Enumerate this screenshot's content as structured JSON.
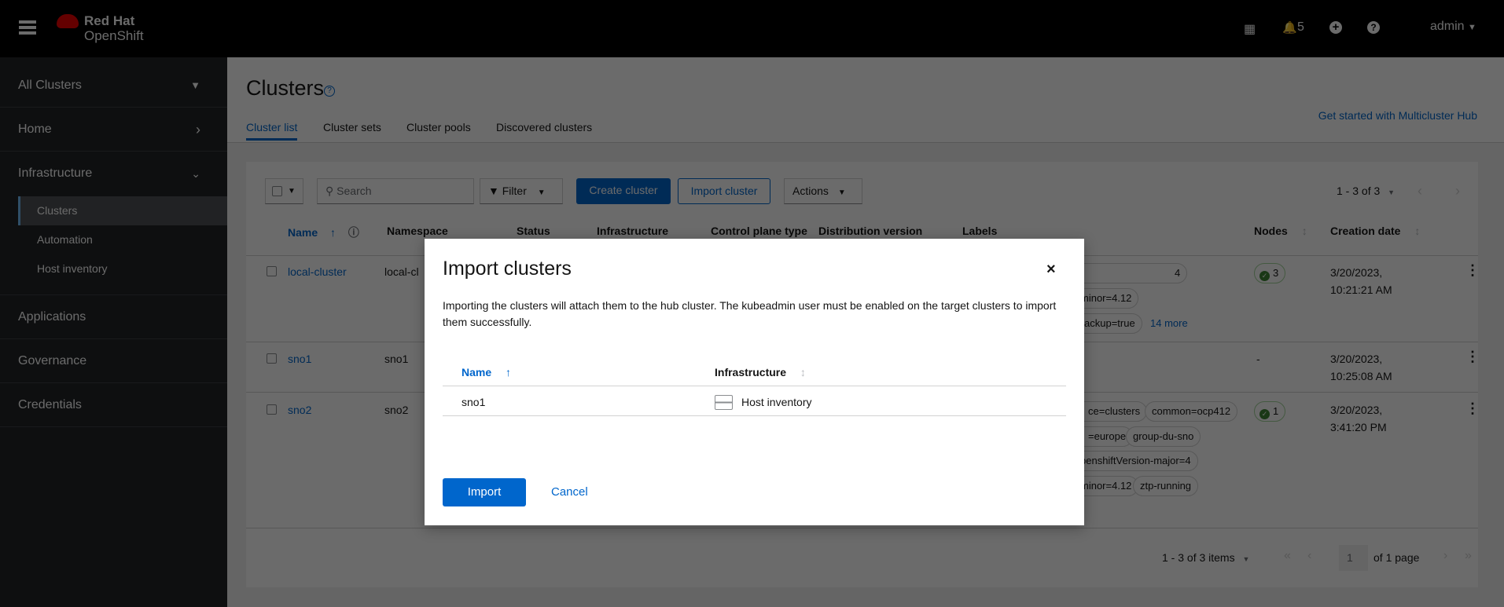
{
  "masthead": {
    "brand_line1": "Red Hat",
    "brand_line2": "OpenShift",
    "notification_count": "5",
    "user": "admin"
  },
  "sidebar": {
    "perspective": "All Clusters",
    "items": [
      {
        "label": "Home"
      },
      {
        "label": "Infrastructure"
      },
      {
        "label": "Applications"
      },
      {
        "label": "Governance"
      },
      {
        "label": "Credentials"
      }
    ],
    "infrastructure_sub": [
      {
        "label": "Clusters"
      },
      {
        "label": "Automation"
      },
      {
        "label": "Host inventory"
      }
    ]
  },
  "page": {
    "title": "Clusters",
    "tabs": [
      {
        "label": "Cluster list"
      },
      {
        "label": "Cluster sets"
      },
      {
        "label": "Cluster pools"
      },
      {
        "label": "Discovered clusters"
      }
    ],
    "get_started_link": "Get started with Multicluster Hub"
  },
  "toolbar": {
    "search_placeholder": "Search",
    "filter": "Filter",
    "create_cluster": "Create cluster",
    "import_cluster": "Import cluster",
    "actions": "Actions",
    "pagination": "1 - 3 of 3"
  },
  "table": {
    "headers": [
      "Name",
      "Namespace",
      "Status",
      "Infrastructure",
      "Control plane type",
      "Distribution version",
      "Labels",
      "Nodes",
      "Creation date"
    ],
    "rows": [
      {
        "name": "local-cluster",
        "namespace": "local-cl",
        "labels": [
          "4",
          "minor=4.12",
          "ackup=true"
        ],
        "more_labels": "14 more",
        "nodes": "3",
        "created_1": "3/20/2023,",
        "created_2": "10:21:21 AM"
      },
      {
        "name": "sno1",
        "namespace": "sno1",
        "labels": [],
        "nodes": "-",
        "created_1": "3/20/2023,",
        "created_2": "10:25:08 AM"
      },
      {
        "name": "sno2",
        "namespace": "sno2",
        "labels": [
          "ce=clusters",
          "common=ocp412",
          "=europe",
          "group-du-sno",
          "penshiftVersion-major=4",
          "minor=4.12",
          "ztp-running"
        ],
        "nodes": "1",
        "created_1": "3/20/2023,",
        "created_2": "3:41:20 PM"
      }
    ]
  },
  "footer_pagination": {
    "range": "1 - 3 of 3 items",
    "page": "1",
    "of_pages": "of 1 page"
  },
  "modal": {
    "title": "Import clusters",
    "description": "Importing the clusters will attach them to the hub cluster. The kubeadmin user must be enabled on the target clusters to import them successfully.",
    "headers": [
      "Name",
      "Infrastructure"
    ],
    "rows": [
      {
        "name": "sno1",
        "infrastructure": "Host inventory"
      }
    ],
    "import": "Import",
    "cancel": "Cancel"
  },
  "colors": {
    "primary": "#0066cc",
    "masthead": "#000000",
    "sidebar": "#212427",
    "success": "#3e8635"
  }
}
